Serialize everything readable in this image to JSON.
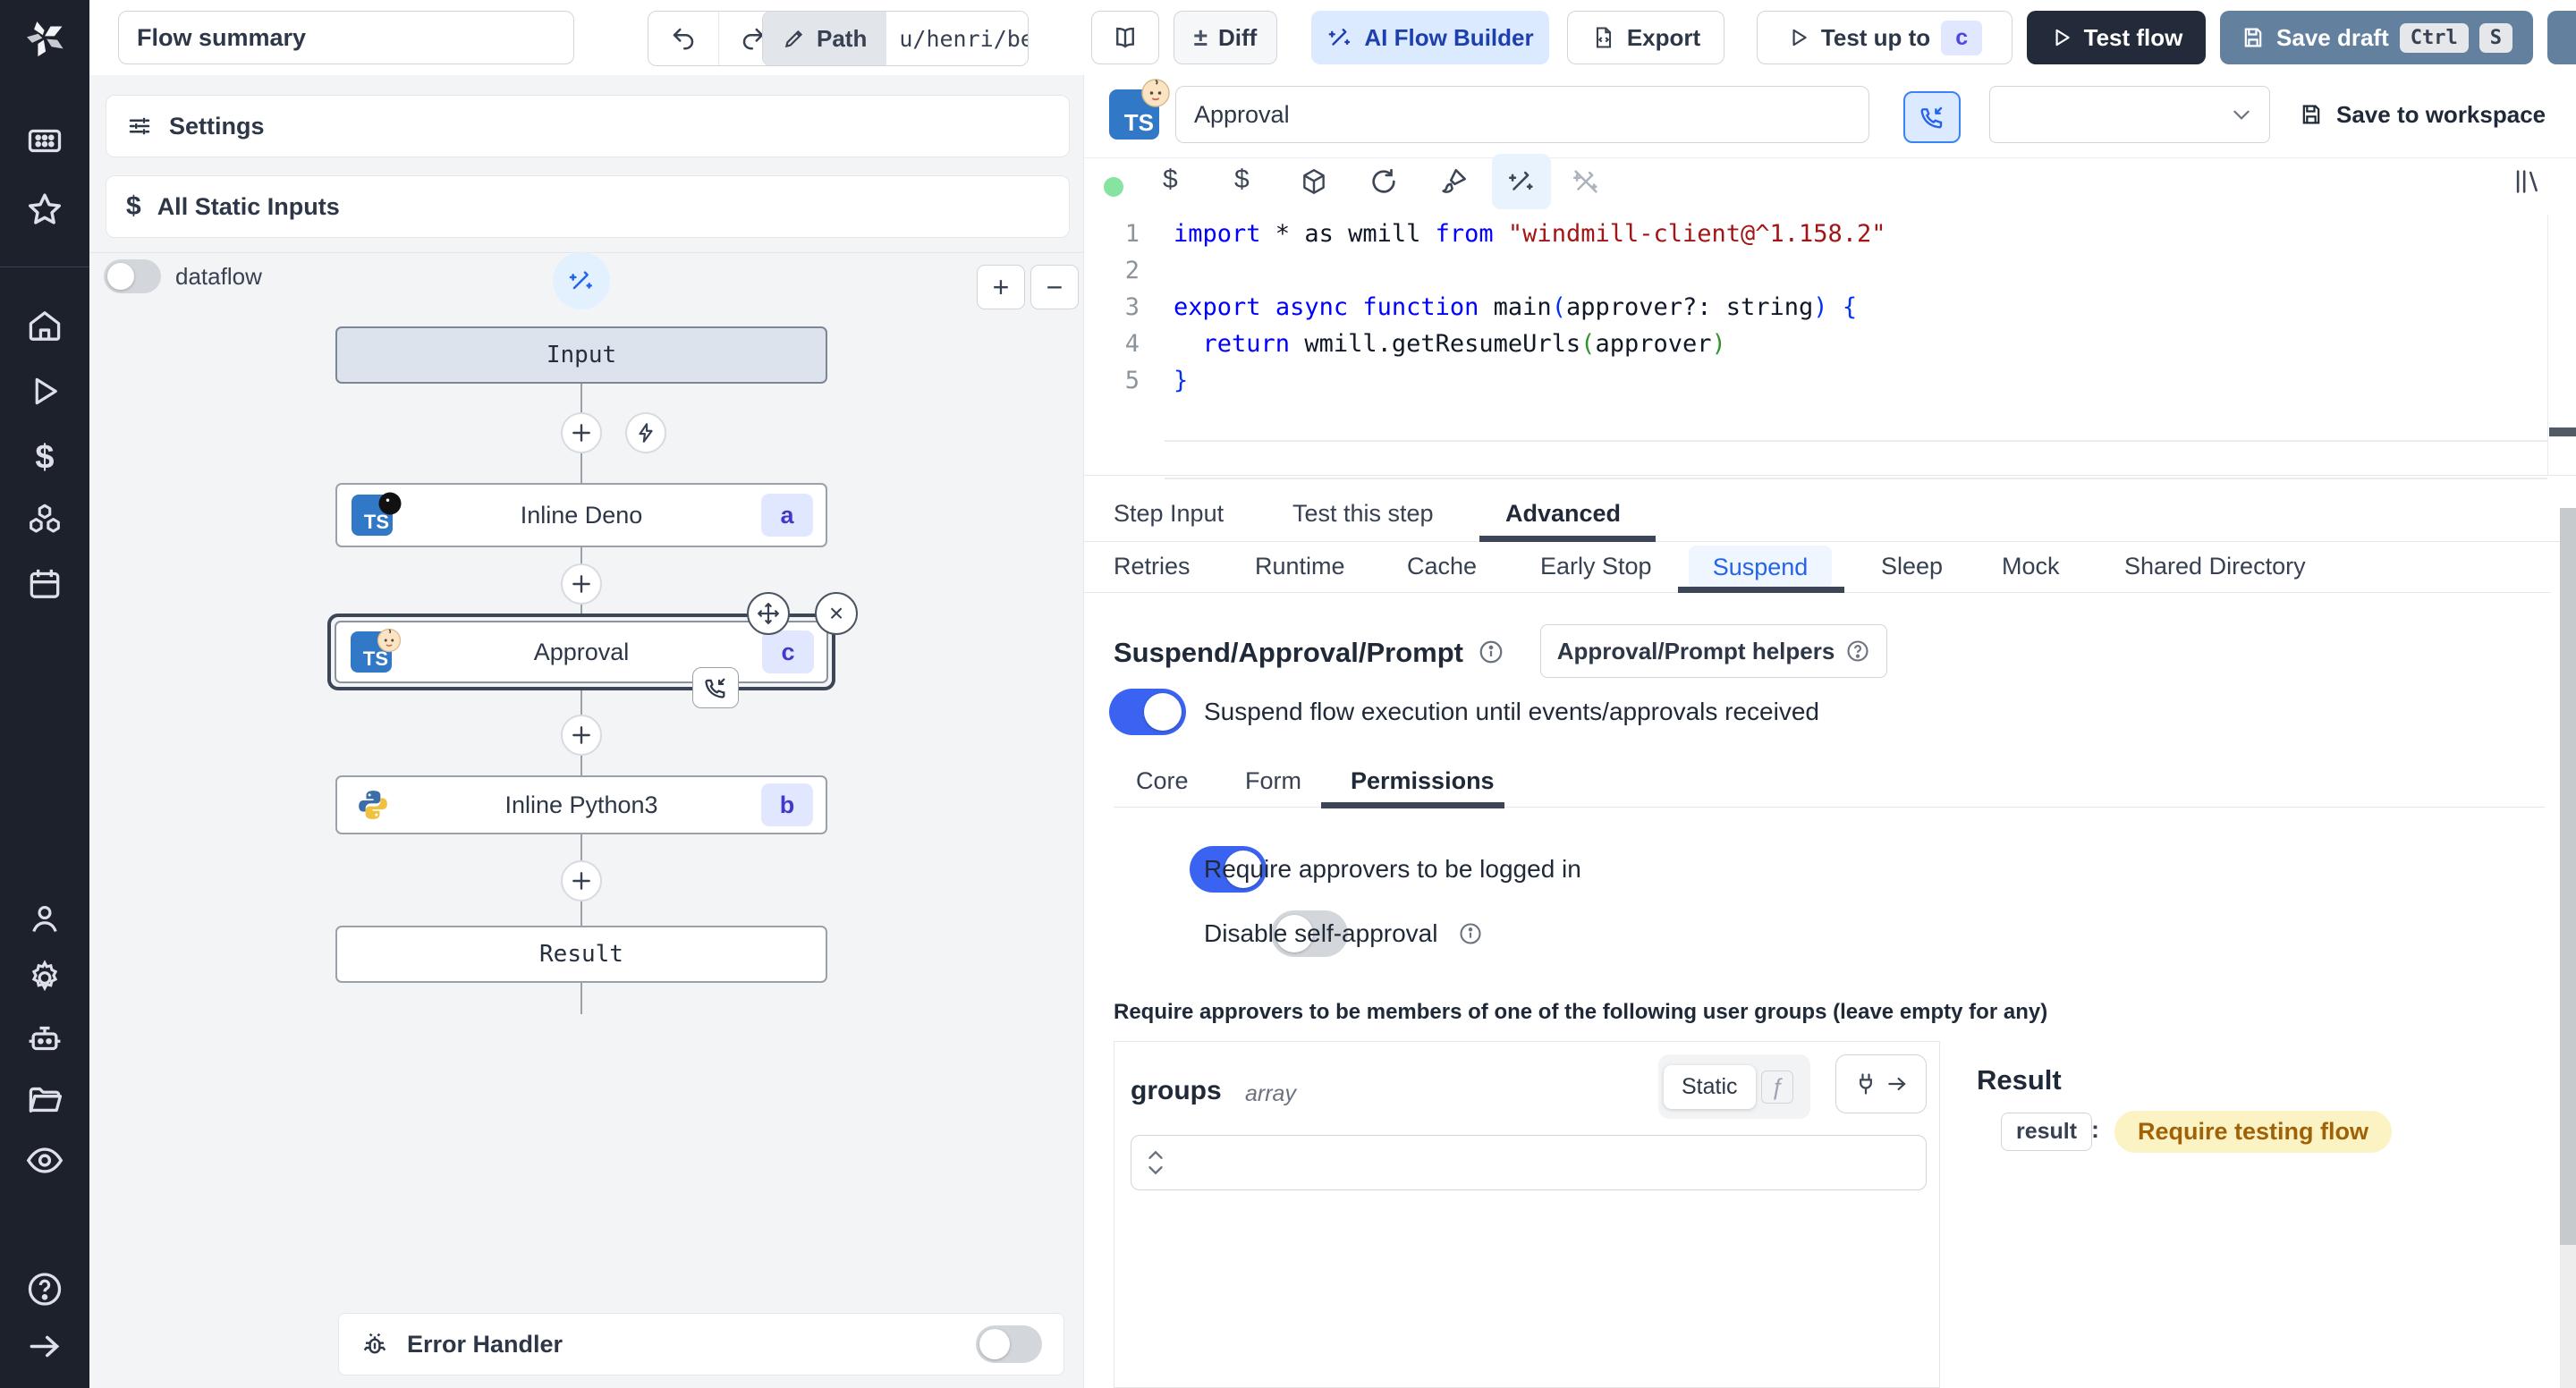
{
  "colors": {
    "accent_blue": "#2563eb",
    "toggle_on": "#3b63f1",
    "dark_button": "#232b3a",
    "save_draft_button": "#64809f",
    "ai_builder_bg": "#dbeafe",
    "badge_bg": "#e0e7ff",
    "badge_text": "#4338ca",
    "result_value_bg": "#fcf3c4",
    "result_value_text": "#a16207",
    "sidebar_bg": "#1c212c"
  },
  "sidebar": {
    "icons": [
      "app-window",
      "star",
      "home",
      "play",
      "dollar",
      "cubes",
      "calendar",
      "person",
      "gear",
      "robot",
      "folder",
      "eye",
      "help",
      "arrow-right"
    ]
  },
  "topbar": {
    "flow_summary_value": "Flow summary",
    "path_label": "Path",
    "path_value": "u/henri/bes",
    "diff_label": "Diff",
    "plusminus": "±",
    "ai_flow_builder_label": "AI Flow Builder",
    "export_label": "Export",
    "test_up_to_label": "Test up to",
    "test_up_to_badge": "c",
    "test_flow_label": "Test flow",
    "save_draft_label": "Save draft",
    "ctrl_key": "Ctrl",
    "s_key": "S"
  },
  "flow_panel": {
    "settings_label": "Settings",
    "all_static_inputs_label": "All Static Inputs",
    "dataflow_label": "dataflow",
    "zoom_in": "+",
    "zoom_out": "−",
    "nodes": {
      "input_label": "Input",
      "deno": {
        "label": "Inline Deno",
        "badge": "a",
        "lang": "TS"
      },
      "approval": {
        "label": "Approval",
        "badge": "c",
        "lang": "TS"
      },
      "python": {
        "label": "Inline Python3",
        "badge": "b"
      },
      "result_label": "Result"
    },
    "error_handler_label": "Error Handler"
  },
  "editor": {
    "script_name_value": "Approval",
    "save_to_workspace_label": "Save to workspace",
    "line_numbers": [
      "1",
      "2",
      "3",
      "4",
      "5"
    ],
    "code": [
      {
        "segs": [
          {
            "t": "import"
          },
          {
            "t": " * as wmill "
          },
          {
            "t": "from"
          },
          {
            "t": " "
          },
          {
            "t": "\"windmill-client@^1.158.2\""
          }
        ]
      },
      {
        "segs": [
          {
            "t": ""
          }
        ]
      },
      {
        "segs": [
          {
            "t": "export"
          },
          {
            "t": " "
          },
          {
            "t": "async"
          },
          {
            "t": " "
          },
          {
            "t": "function"
          },
          {
            "t": " main"
          },
          {
            "t": "("
          },
          {
            "t": "approver?: string"
          },
          {
            "t": ")"
          },
          {
            "t": " "
          },
          {
            "t": "{"
          }
        ]
      },
      {
        "segs": [
          {
            "t": "  "
          },
          {
            "t": "return"
          },
          {
            "t": " wmill.getResumeUrls"
          },
          {
            "t": "("
          },
          {
            "t": "approver"
          },
          {
            "t": ")"
          }
        ]
      },
      {
        "segs": [
          {
            "t": "}"
          }
        ]
      }
    ]
  },
  "tabs": {
    "main": [
      "Step Input",
      "Test this step",
      "Advanced"
    ],
    "advanced": [
      "Retries",
      "Runtime",
      "Cache",
      "Early Stop",
      "Suspend",
      "Sleep",
      "Mock",
      "Shared Directory"
    ]
  },
  "suspend": {
    "heading": "Suspend/Approval/Prompt",
    "helpers_button": "Approval/Prompt helpers",
    "suspend_toggle_label": "Suspend flow execution until events/approvals received",
    "sub_tabs": [
      "Core",
      "Form",
      "Permissions"
    ],
    "require_login_label": "Require approvers to be logged in",
    "disable_self_approval_label": "Disable self-approval",
    "groups_note": "Require approvers to be members of one of the following user groups (leave empty for any)"
  },
  "groups": {
    "name": "groups",
    "type": "array",
    "static_label": "Static",
    "fn_symbol": "ƒ",
    "input_value": ""
  },
  "result": {
    "title": "Result",
    "key": "result",
    "colon": ":",
    "value": "Require testing flow"
  }
}
